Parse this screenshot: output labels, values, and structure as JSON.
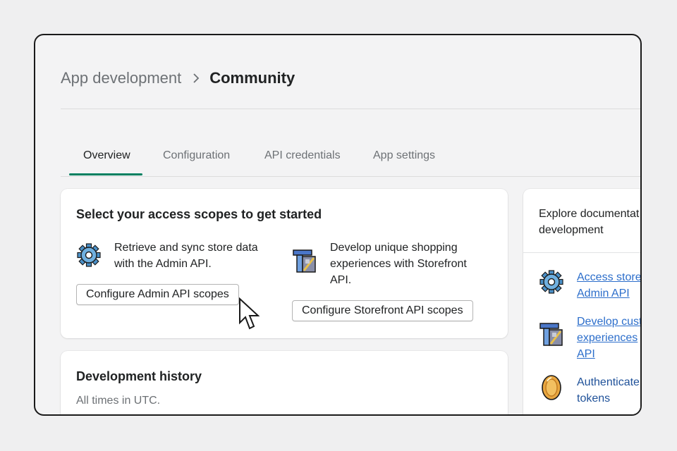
{
  "breadcrumb": {
    "parent": "App development",
    "current": "Community"
  },
  "tabs": [
    {
      "label": "Overview",
      "active": true
    },
    {
      "label": "Configuration",
      "active": false
    },
    {
      "label": "API credentials",
      "active": false
    },
    {
      "label": "App settings",
      "active": false
    }
  ],
  "scopes_card": {
    "title": "Select your access scopes to get started",
    "admin": {
      "line1": "Retrieve and sync store data",
      "line2": "with the Admin API.",
      "button": "Configure Admin API scopes",
      "icon": "gear-icon"
    },
    "storefront": {
      "line1": "Develop unique shopping",
      "line2": "experiences with Storefront",
      "line3": "API.",
      "button": "Configure Storefront API scopes",
      "icon": "storefront-icon"
    }
  },
  "history_card": {
    "title": "Development history",
    "subtitle": "All times in UTC."
  },
  "docs_card": {
    "line1": "Explore documentat",
    "line2": "development",
    "links": [
      {
        "line1": "Access store",
        "line2": "Admin API",
        "icon": "gear-icon"
      },
      {
        "line1": "Develop cust",
        "line2": "experiences",
        "line3": "API",
        "icon": "storefront-icon"
      },
      {
        "line1": "Authenticate",
        "line2": "tokens",
        "icon": "coin-icon"
      }
    ]
  },
  "colors": {
    "accent": "#008060",
    "link": "#2c6ecb",
    "gear": "#4a90c8"
  }
}
